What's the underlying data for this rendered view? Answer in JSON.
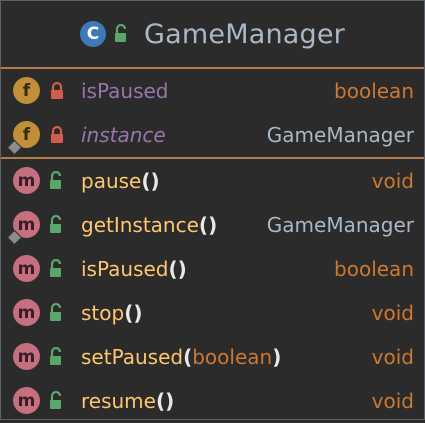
{
  "class": {
    "name": "GameManager",
    "badge_letter": "C",
    "visibility": "public"
  },
  "fields": [
    {
      "name": "isPaused",
      "type": "boolean",
      "badge": "f",
      "visibility": "private",
      "static": false
    },
    {
      "name": "instance",
      "type": "GameManager",
      "badge": "f",
      "visibility": "private",
      "static": true
    }
  ],
  "methods": [
    {
      "name": "pause",
      "open": "(",
      "params": "",
      "close": ")",
      "type": "void",
      "badge": "m",
      "visibility": "public",
      "static": false
    },
    {
      "name": "getInstance",
      "open": "(",
      "params": "",
      "close": ")",
      "type": "GameManager",
      "badge": "m",
      "visibility": "public",
      "static": true
    },
    {
      "name": "isPaused",
      "open": "(",
      "params": "",
      "close": ")",
      "type": "boolean",
      "badge": "m",
      "visibility": "public",
      "static": false
    },
    {
      "name": "stop",
      "open": "(",
      "params": "",
      "close": ")",
      "type": "void",
      "badge": "m",
      "visibility": "public",
      "static": false
    },
    {
      "name": "setPaused",
      "open": "(",
      "params": "boolean",
      "close": ")",
      "type": "void",
      "badge": "m",
      "visibility": "public",
      "static": false
    },
    {
      "name": "resume",
      "open": "(",
      "params": "",
      "close": ")",
      "type": "void",
      "badge": "m",
      "visibility": "public",
      "static": false
    }
  ],
  "colors": {
    "background": "#2b2b2b",
    "separator": "#b3794a",
    "field_name": "#9876aa",
    "method_name": "#ffc66d",
    "primitive_type": "#cc7832",
    "class_type": "#a9b7c6",
    "class_badge": "#3d7ab8",
    "field_badge": "#c08f37",
    "method_badge": "#c4707f",
    "lock_private": "#d05d4e",
    "lock_public": "#59a869"
  },
  "icons": {
    "class_visibility": "unlocked-padlock-icon",
    "private": "locked-padlock-icon",
    "public": "unlocked-padlock-icon",
    "static": "static-pin-icon"
  }
}
